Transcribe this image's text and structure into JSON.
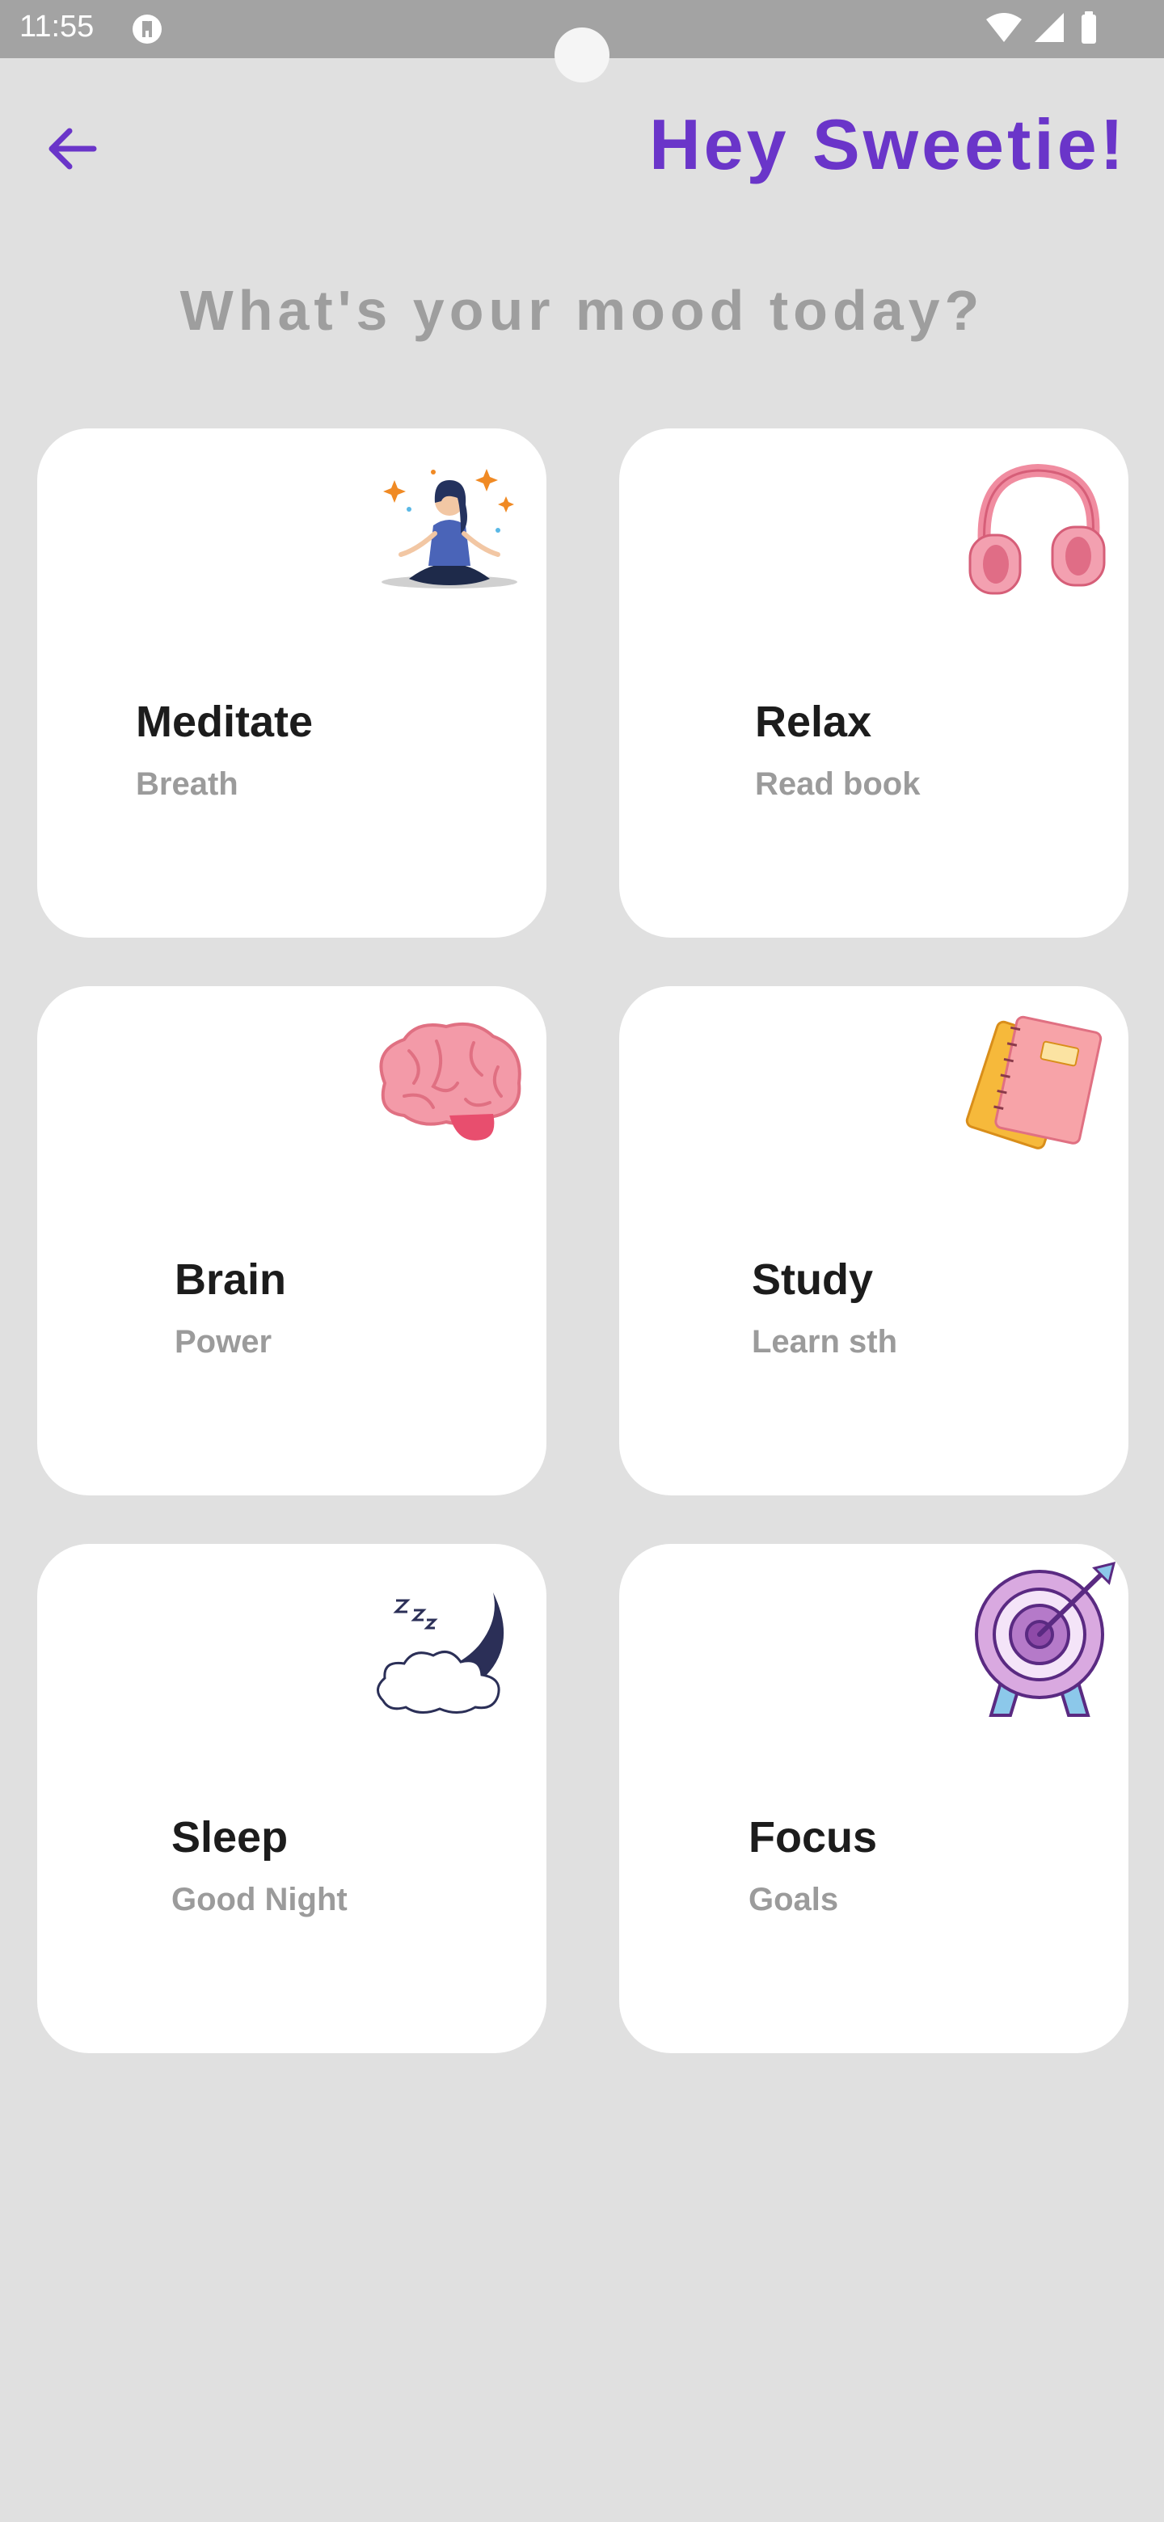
{
  "status_bar": {
    "time": "11:55",
    "icons": [
      "app-notification-icon",
      "wifi-icon",
      "signal-icon",
      "battery-icon"
    ]
  },
  "header": {
    "back_icon": "arrow-left-icon",
    "greeting": "Hey Sweetie!"
  },
  "question": "What's your mood today?",
  "colors": {
    "accent": "#6a35c9",
    "background": "#e0e0e0",
    "card": "#ffffff",
    "title_text": "#1c1c1c",
    "subtitle_text": "#9b9b9b"
  },
  "cards": [
    {
      "title": "Meditate",
      "subtitle": "Breath",
      "icon": "meditation-icon"
    },
    {
      "title": "Relax",
      "subtitle": "Read book",
      "icon": "headphones-icon"
    },
    {
      "title": "Brain",
      "subtitle": "Power",
      "icon": "brain-icon"
    },
    {
      "title": "Study",
      "subtitle": "Learn sth",
      "icon": "notebook-icon"
    },
    {
      "title": "Sleep",
      "subtitle": "Good Night",
      "icon": "moon-icon"
    },
    {
      "title": "Focus",
      "subtitle": "Goals",
      "icon": "target-icon"
    }
  ]
}
